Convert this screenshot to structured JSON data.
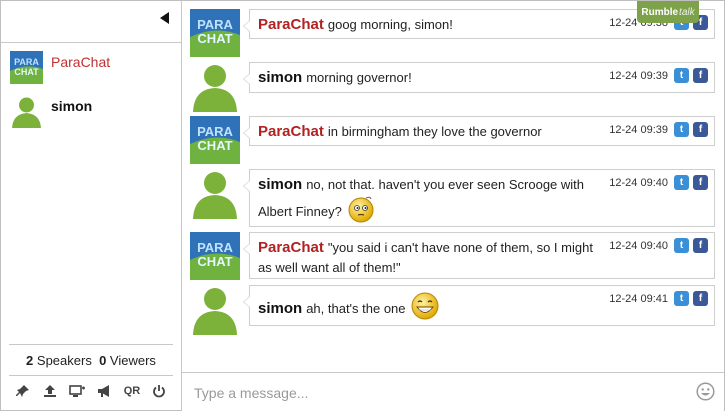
{
  "sidebar": {
    "users": [
      {
        "name": "ParaChat",
        "type": "parachat"
      },
      {
        "name": "simon",
        "type": "simon"
      }
    ],
    "stats": {
      "speakers": "2",
      "speakers_label": "Speakers",
      "viewers": "0",
      "viewers_label": "Viewers"
    },
    "tools": [
      "pin-icon",
      "upload-icon",
      "add-screen-icon",
      "megaphone-icon",
      "qr-icon",
      "power-icon"
    ],
    "qr_label": "QR"
  },
  "brand": {
    "part1": "Rumble",
    "part2": "talk"
  },
  "messages": [
    {
      "author": "ParaChat",
      "text": "goog morning, simon!",
      "time": "12-24 09:38",
      "emoji": ""
    },
    {
      "author": "simon",
      "text": "morning governor!",
      "time": "12-24 09:39",
      "emoji": ""
    },
    {
      "author": "ParaChat",
      "text": "in birmingham they love the governor",
      "time": "12-24 09:39",
      "emoji": ""
    },
    {
      "author": "simon",
      "text": "no, not that. haven't you ever seen Scrooge with Albert Finney?",
      "time": "12-24 09:40",
      "emoji": "thinking"
    },
    {
      "author": "ParaChat",
      "text": "\"you said i can't have none of them, so I might as well want all of them!\"",
      "time": "12-24 09:40",
      "emoji": ""
    },
    {
      "author": "simon",
      "text": "ah, that's the one",
      "time": "12-24 09:41",
      "emoji": "grin"
    }
  ],
  "social": {
    "twitter_glyph": "t",
    "facebook_glyph": "f"
  },
  "composer": {
    "placeholder": "Type a message..."
  }
}
